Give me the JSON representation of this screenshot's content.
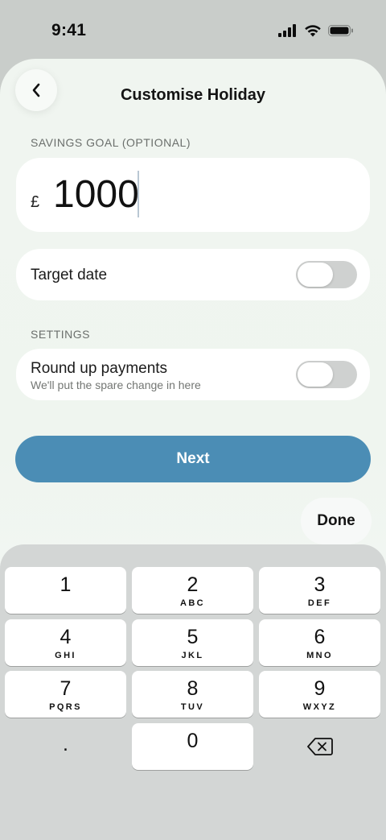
{
  "status_bar": {
    "time": "9:41"
  },
  "header": {
    "title": "Customise Holiday",
    "back_icon": "chevron-left-icon"
  },
  "savings_goal": {
    "label": "SAVINGS GOAL (OPTIONAL)",
    "currency": "£",
    "amount": "1000"
  },
  "target_date": {
    "label": "Target date",
    "enabled": false
  },
  "settings": {
    "label": "SETTINGS",
    "round_up": {
      "label": "Round up payments",
      "description": "We'll put the spare change in here",
      "enabled": false
    }
  },
  "actions": {
    "next_label": "Next",
    "done_label": "Done"
  },
  "keyboard": {
    "keys": [
      {
        "num": "1",
        "letters": ""
      },
      {
        "num": "2",
        "letters": "ABC"
      },
      {
        "num": "3",
        "letters": "DEF"
      },
      {
        "num": "4",
        "letters": "GHI"
      },
      {
        "num": "5",
        "letters": "JKL"
      },
      {
        "num": "6",
        "letters": "MNO"
      },
      {
        "num": "7",
        "letters": "PQRS"
      },
      {
        "num": "8",
        "letters": "TUV"
      },
      {
        "num": "9",
        "letters": "WXYZ"
      },
      {
        "num": ".",
        "letters": ""
      },
      {
        "num": "0",
        "letters": ""
      }
    ],
    "delete_icon": "backspace-icon"
  },
  "colors": {
    "accent": "#4b8db5",
    "background": "#eff5ef",
    "keyboard": "#d3d6d5"
  }
}
